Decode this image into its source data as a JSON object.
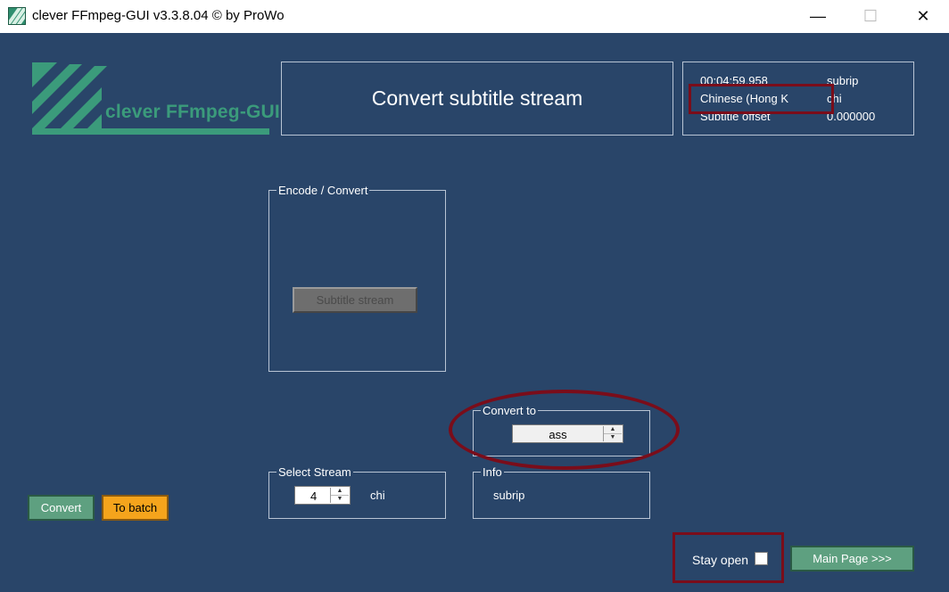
{
  "window": {
    "title": "clever FFmpeg-GUI v3.3.8.04   © by ProWo",
    "minimize_glyph": "—",
    "maximize_glyph": "☐",
    "close_glyph": "✕"
  },
  "logo": {
    "text": "clever FFmpeg-GUI",
    "color": "#3b9b7b"
  },
  "heading": {
    "text": "Convert subtitle stream"
  },
  "info": {
    "duration": "00:04:59.958",
    "codec": "subrip",
    "language_name": "Chinese (Hong K",
    "language_code": "chi",
    "offset_label": "Subtitle offset",
    "offset_value": "0.000000"
  },
  "encode_group": {
    "legend": "Encode / Convert",
    "button_label": "Subtitle stream"
  },
  "convert_to_group": {
    "legend": "Convert to",
    "value": "ass"
  },
  "select_stream_group": {
    "legend": "Select Stream",
    "value": "4",
    "language": "chi"
  },
  "info_group": {
    "legend": "Info",
    "value": "subrip"
  },
  "actions": {
    "convert_label": "Convert",
    "batch_label": "To batch",
    "stay_open_label": "Stay open",
    "main_page_label": "Main Page >>>"
  },
  "colors": {
    "background": "#294569",
    "accent_green": "#5ea080",
    "batch_orange": "#f5a41c",
    "annotation_red": "#7a0d1a"
  }
}
